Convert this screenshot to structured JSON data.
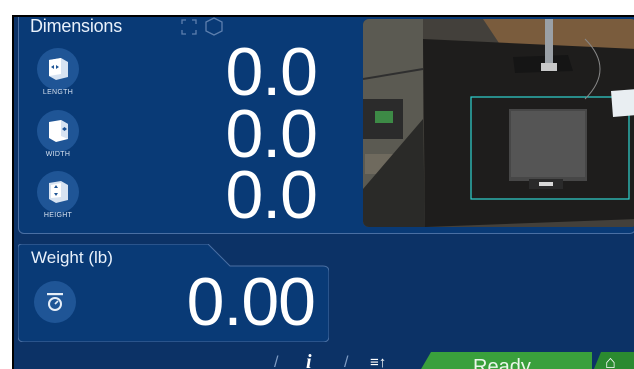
{
  "dimensions": {
    "title": "Dimensions",
    "rows": [
      {
        "label": "LENGTH",
        "value": "0.0",
        "icon": "length-icon"
      },
      {
        "label": "WIDTH",
        "value": "0.0",
        "icon": "width-icon"
      },
      {
        "label": "HEIGHT",
        "value": "0.0",
        "icon": "height-icon"
      }
    ]
  },
  "weight": {
    "title": "Weight (lb)",
    "value": "0.00",
    "icon": "scale-icon"
  },
  "toolbar": {
    "separator": "/",
    "info_symbol": "i",
    "sort_symbol": "≡↑",
    "status_label": "Ready",
    "status_symbol": "⌂"
  },
  "colors": {
    "background": "#0c3266",
    "panel": "#093a76",
    "ready": "#3aa03c",
    "detection_box": "#2fd6d2"
  }
}
